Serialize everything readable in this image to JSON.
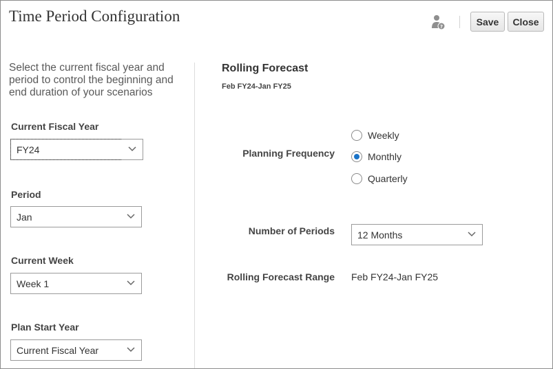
{
  "header": {
    "title": "Time Period Configuration",
    "save_label": "Save",
    "close_label": "Close"
  },
  "left": {
    "intro": "Select the current fiscal year and period to control the beginning and end duration of your scenarios",
    "fiscal_year": {
      "label": "Current Fiscal Year",
      "value": "FY24"
    },
    "period": {
      "label": "Period",
      "value": "Jan"
    },
    "week": {
      "label": "Current Week",
      "value": "Week 1"
    },
    "plan_start": {
      "label": "Plan Start Year",
      "value": "Current Fiscal Year"
    }
  },
  "right": {
    "title": "Rolling Forecast",
    "subtitle": "Feb FY24-Jan FY25",
    "planning_frequency": {
      "label": "Planning Frequency",
      "options": [
        "Weekly",
        "Monthly",
        "Quarterly"
      ],
      "selected": "Monthly"
    },
    "number_of_periods": {
      "label": "Number of Periods",
      "value": "12 Months"
    },
    "range": {
      "label": "Rolling Forecast Range",
      "value": "Feb FY24-Jan FY25"
    }
  },
  "colors": {
    "accent": "#1a73c8",
    "text": "#333333",
    "border": "#9a9a9a"
  },
  "icons": [
    "help-person-icon",
    "chevron-down-icon"
  ]
}
